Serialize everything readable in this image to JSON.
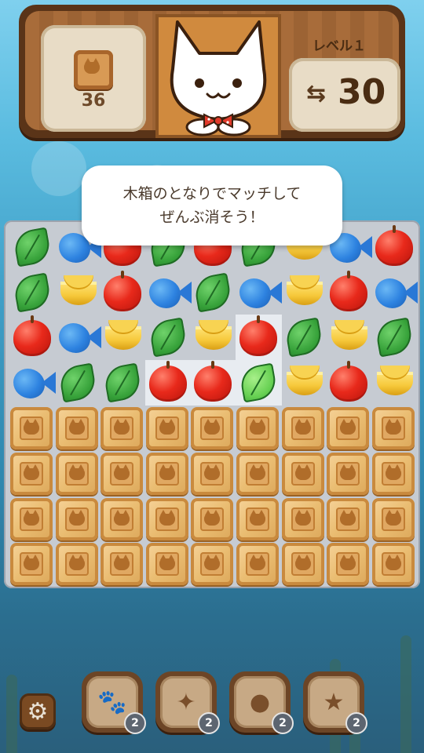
{
  "header": {
    "goal_count": "36",
    "level_label": "レベル１",
    "moves_count": "30"
  },
  "speech": {
    "line1": "木箱のとなりでマッチして",
    "line2": "ぜんぶ消そう！"
  },
  "board": {
    "rows": [
      [
        "leaf",
        "fish",
        "apple",
        "leaf",
        "apple",
        "leaf",
        "banana",
        "fish",
        "apple"
      ],
      [
        "leaf",
        "banana",
        "apple",
        "fish",
        "leaf",
        "fish",
        "banana",
        "apple",
        "fish"
      ],
      [
        "apple",
        "fish",
        "banana",
        "leaf",
        "banana",
        "apple",
        "leaf",
        "banana",
        "leaf"
      ],
      [
        "fish",
        "leaf",
        "leaf",
        "apple",
        "apple",
        "leaf-bright",
        "banana",
        "apple",
        "banana"
      ]
    ],
    "crate_rows": 4,
    "crate_cols": 9
  },
  "boosters": [
    {
      "name": "paw-hammer",
      "icon": "🐾",
      "count": "2"
    },
    {
      "name": "shuffle-arrows",
      "icon": "✦",
      "count": "2"
    },
    {
      "name": "bomb",
      "icon": "●",
      "count": "2"
    },
    {
      "name": "star-wand",
      "icon": "★",
      "count": "2"
    }
  ],
  "icons": {
    "settings": "gear-icon",
    "moves": "swap-arrows-icon"
  },
  "colors": {
    "wood": "#9c6334",
    "board": "#c6cbd2",
    "crate": "#eabd72"
  }
}
